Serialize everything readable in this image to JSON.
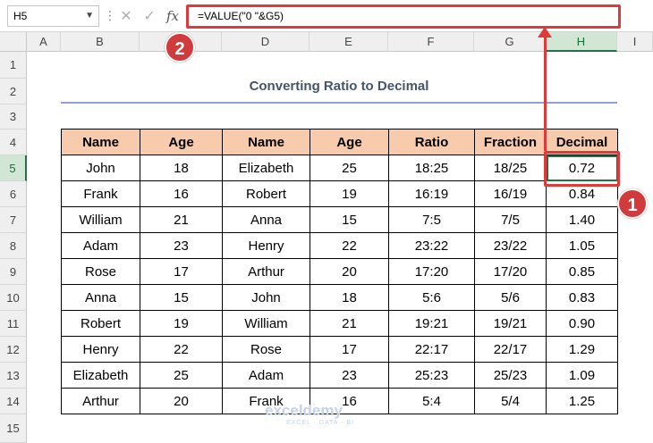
{
  "namebox": {
    "value": "H5"
  },
  "formula_bar": {
    "cancel_glyph": "✕",
    "enter_glyph": "✓",
    "fx_label": "fx",
    "formula": "=VALUE(\"0 \"&G5)"
  },
  "columns": [
    "A",
    "B",
    "C",
    "D",
    "E",
    "F",
    "G",
    "H",
    "I"
  ],
  "selected_column": "H",
  "rows": [
    "1",
    "2",
    "3",
    "4",
    "5",
    "6",
    "7",
    "8",
    "9",
    "10",
    "11",
    "12",
    "13",
    "14",
    "15"
  ],
  "selected_row": "5",
  "title": "Converting Ratio to Decimal",
  "table": {
    "headers": [
      "Name",
      "Age",
      "Name",
      "Age",
      "Ratio",
      "Fraction",
      "Decimal"
    ],
    "rows": [
      [
        "John",
        "18",
        "Elizabeth",
        "25",
        "18:25",
        "18/25",
        "0.72"
      ],
      [
        "Frank",
        "16",
        "Robert",
        "19",
        "16:19",
        "16/19",
        "0.84"
      ],
      [
        "William",
        "21",
        "Anna",
        "15",
        "7:5",
        "7/5",
        "1.40"
      ],
      [
        "Adam",
        "23",
        "Henry",
        "22",
        "23:22",
        "23/22",
        "1.05"
      ],
      [
        "Rose",
        "17",
        "Arthur",
        "20",
        "17:20",
        "17/20",
        "0.85"
      ],
      [
        "Anna",
        "15",
        "John",
        "18",
        "5:6",
        "5/6",
        "0.83"
      ],
      [
        "Robert",
        "19",
        "William",
        "21",
        "19:21",
        "19/21",
        "0.90"
      ],
      [
        "Henry",
        "22",
        "Rose",
        "17",
        "22:17",
        "22/17",
        "1.29"
      ],
      [
        "Elizabeth",
        "25",
        "Adam",
        "23",
        "25:23",
        "25/23",
        "1.09"
      ],
      [
        "Arthur",
        "20",
        "Frank",
        "16",
        "5:4",
        "5/4",
        "1.25"
      ]
    ]
  },
  "annotations": {
    "badge1": "1",
    "badge2": "2"
  },
  "watermark": {
    "brand": "exceldemy",
    "tagline": "EXCEL · DATA · BI"
  },
  "colors": {
    "accent_red": "#dd3a3a",
    "header_fill": "#f8cbad",
    "excel_green": "#217346",
    "title_color": "#44546a"
  }
}
